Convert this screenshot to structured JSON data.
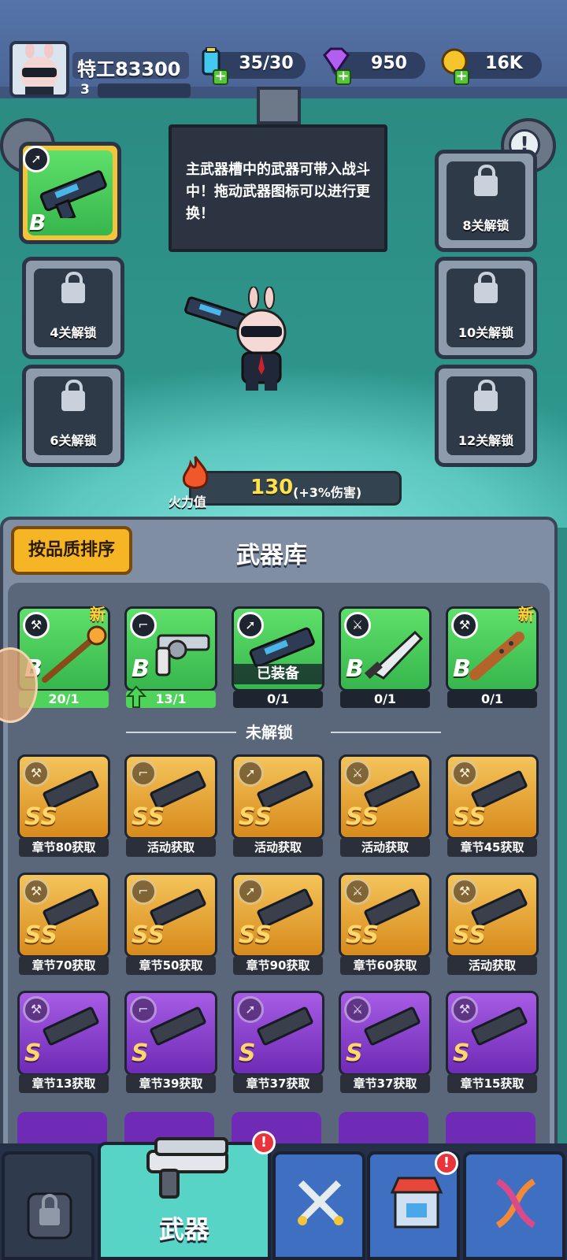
{
  "player": {
    "name": "特工83300",
    "level": "3",
    "level_progress": 0.0
  },
  "resources": {
    "energy": "35/30",
    "gems": "950",
    "coins": "16K"
  },
  "tip": "主武器槽中的武器可带入战斗中！拖动武器图标可以进行更换！",
  "slots": {
    "left": [
      {
        "label": ""
      },
      {
        "label": "4关解锁"
      },
      {
        "label": "6关解锁"
      }
    ],
    "right": [
      {
        "label": "8关解锁"
      },
      {
        "label": "10关解锁"
      },
      {
        "label": "12关解锁"
      }
    ]
  },
  "firepower": {
    "label": "火力值",
    "value": "130",
    "bonus": "(+3%伤害)"
  },
  "armory": {
    "sort_button": "按品质排序",
    "title": "武器库",
    "owned": [
      {
        "grade": "B",
        "count": "20/1",
        "progress": 1.0,
        "new": "新",
        "equipped": ""
      },
      {
        "grade": "B",
        "count": "13/1",
        "progress": 1.0,
        "new": "",
        "equipped": ""
      },
      {
        "grade": "",
        "count": "0/1",
        "progress": 0.0,
        "new": "",
        "equipped": "已装备"
      },
      {
        "grade": "B",
        "count": "0/1",
        "progress": 0.0,
        "new": "",
        "equipped": ""
      },
      {
        "grade": "B",
        "count": "0/1",
        "progress": 0.0,
        "new": "新",
        "equipped": ""
      }
    ],
    "locked_label": "未解锁",
    "locked_rows": [
      [
        {
          "grade": "SS",
          "source": "章节80获取"
        },
        {
          "grade": "SS",
          "source": "活动获取"
        },
        {
          "grade": "SS",
          "source": "活动获取"
        },
        {
          "grade": "SS",
          "source": "活动获取"
        },
        {
          "grade": "SS",
          "source": "章节45获取"
        }
      ],
      [
        {
          "grade": "SS",
          "source": "章节70获取"
        },
        {
          "grade": "SS",
          "source": "章节50获取"
        },
        {
          "grade": "SS",
          "source": "章节90获取"
        },
        {
          "grade": "SS",
          "source": "章节60获取"
        },
        {
          "grade": "SS",
          "source": "活动获取"
        }
      ],
      [
        {
          "grade": "S",
          "source": "章节13获取"
        },
        {
          "grade": "S",
          "source": "章节39获取"
        },
        {
          "grade": "S",
          "source": "章节37获取"
        },
        {
          "grade": "S",
          "source": "章节37获取"
        },
        {
          "grade": "S",
          "source": "章节15获取"
        }
      ]
    ]
  },
  "nav": {
    "active_tab": "武器",
    "badge": "!"
  },
  "colors": {
    "green": "#36b64c",
    "gold": "#d88a1c",
    "purple": "#6f2bb6",
    "accent": "#f6b525"
  }
}
